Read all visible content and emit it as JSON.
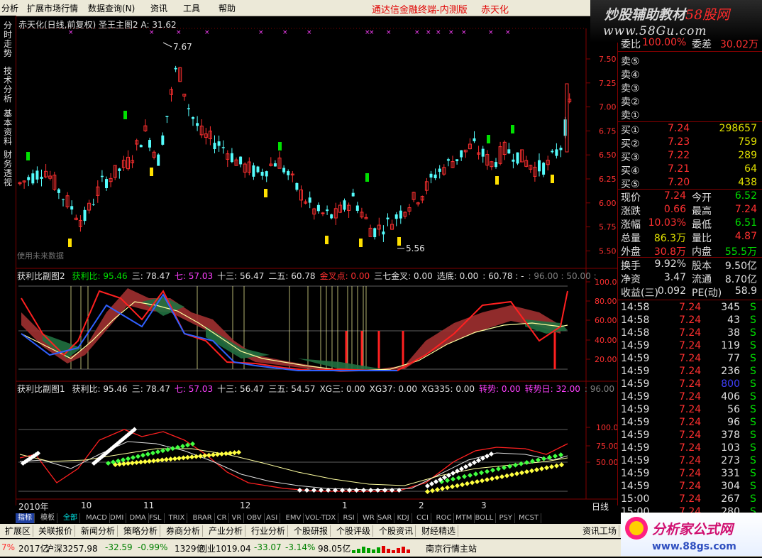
{
  "menu": [
    "分析",
    "扩展市场行情",
    "数据查询(N)",
    "资讯",
    "工具",
    "帮助"
  ],
  "app_title": "通达信金融终端-内测版",
  "stock_name_title": "赤天化",
  "brand": {
    "main": "炒股辅助教材",
    "accent": "58股网",
    "url": "www.58Gu.com"
  },
  "left_tabs": [
    "分时走势",
    "技术分析",
    "基本资料",
    "财务透视"
  ],
  "main_chart": {
    "header_name": "赤天化(日线,前复权)",
    "indicator": "圣王主图2",
    "a_label": "A: 31.62",
    "y_ticks": [
      "7.50",
      "7.25",
      "7.00",
      "6.75",
      "6.50",
      "6.25",
      "6.00",
      "5.75",
      "5.50"
    ],
    "y_values": [
      7.5,
      7.25,
      7.0,
      6.75,
      6.5,
      6.25,
      6.0,
      5.75,
      5.5
    ],
    "high_label": "7.67",
    "low_label": "5.56",
    "watermark": "使用未来数据"
  },
  "sub1": {
    "name": "获利比副图2",
    "items": [
      {
        "t": "获利比: 95.46",
        "c": "#00e000"
      },
      {
        "t": "三: 78.47",
        "c": "#e0e0e0"
      },
      {
        "t": "七: 57.03",
        "c": "#ff40ff"
      },
      {
        "t": "十三: 56.47",
        "c": "#e0e0e0"
      },
      {
        "t": "二五: 60.78",
        "c": "#e0e0e0"
      },
      {
        "t": "金叉点: 0.00",
        "c": "#ff3030"
      },
      {
        "t": "三七金叉: 0.00",
        "c": "#e0e0e0"
      },
      {
        "t": "选底: 0.00",
        "c": "#e0e0e0"
      },
      {
        "t": ": 60.78 : -",
        "c": "#e0e0e0"
      },
      {
        "t": ": 96.00 : 50.00 :",
        "c": "#808080"
      }
    ],
    "y_ticks": [
      "100.0",
      "80.00",
      "60.00",
      "40.00",
      "20.00"
    ]
  },
  "sub2": {
    "name": "获利比副图1",
    "items": [
      {
        "t": "获利比: 95.46",
        "c": "#e0e0e0"
      },
      {
        "t": "三: 78.47",
        "c": "#e0e0e0"
      },
      {
        "t": "七: 57.03",
        "c": "#ff40ff"
      },
      {
        "t": "十三: 56.47",
        "c": "#e0e0e0"
      },
      {
        "t": "三五: 54.57",
        "c": "#e0e0e0"
      },
      {
        "t": "XG三: 0.00",
        "c": "#e0e0e0"
      },
      {
        "t": "XG37: 0.00",
        "c": "#e0e0e0"
      },
      {
        "t": "XG335: 0.00",
        "c": "#e0e0e0"
      },
      {
        "t": "转势: 0.00",
        "c": "#ff40ff"
      },
      {
        "t": "转势日: 32.00",
        "c": "#ff40ff"
      },
      {
        "t": ": 96.00",
        "c": "#808080"
      }
    ],
    "y_ticks": [
      "100.0",
      "75.00",
      "50.00"
    ]
  },
  "date_axis": {
    "labels": [
      "2010年",
      "10",
      "11",
      "12",
      "1",
      "2",
      "3"
    ],
    "period": "日线"
  },
  "quote": {
    "top": {
      "label1": "委比",
      "val1": "100.00%",
      "label2": "委差",
      "val2": "30.02万"
    },
    "sell": [
      {
        "label": "卖⑤"
      },
      {
        "label": "卖④"
      },
      {
        "label": "卖③"
      },
      {
        "label": "卖②"
      },
      {
        "label": "卖①"
      }
    ],
    "buy": [
      {
        "label": "买①",
        "price": "7.24",
        "vol": "298657"
      },
      {
        "label": "买②",
        "price": "7.23",
        "vol": "759"
      },
      {
        "label": "买③",
        "price": "7.22",
        "vol": "289"
      },
      {
        "label": "买④",
        "price": "7.21",
        "vol": "64"
      },
      {
        "label": "买⑤",
        "price": "7.20",
        "vol": "438"
      }
    ],
    "stats": [
      {
        "l1": "现价",
        "v1": "7.24",
        "c1": "red",
        "l2": "今开",
        "v2": "6.52",
        "c2": "grn"
      },
      {
        "l1": "涨跌",
        "v1": "0.66",
        "c1": "red",
        "l2": "最高",
        "v2": "7.24",
        "c2": "red"
      },
      {
        "l1": "涨幅",
        "v1": "10.03%",
        "c1": "red",
        "l2": "最低",
        "v2": "6.51",
        "c2": "grn"
      },
      {
        "l1": "总量",
        "v1": "86.3万",
        "c1": "ylw",
        "l2": "量比",
        "v2": "4.87",
        "c2": "red"
      },
      {
        "l1": "外盘",
        "v1": "30.8万",
        "c1": "red",
        "l2": "内盘",
        "v2": "55.5万",
        "c2": "grn"
      }
    ],
    "stats2": [
      {
        "l1": "换手",
        "v1": "9.92%",
        "l2": "股本",
        "v2": "9.50亿"
      },
      {
        "l1": "净资",
        "v1": "3.47",
        "l2": "流通",
        "v2": "8.70亿"
      },
      {
        "l1": "收益(三)",
        "v1": "0.092",
        "l2": "PE(动)",
        "v2": "58.9"
      }
    ],
    "ticks": [
      {
        "time": "14:58",
        "price": "7.24",
        "vol": "345",
        "side": "S",
        "vc": "wht"
      },
      {
        "time": "14:58",
        "price": "7.24",
        "vol": "43",
        "side": "S",
        "vc": "wht"
      },
      {
        "time": "14:58",
        "price": "7.24",
        "vol": "38",
        "side": "S",
        "vc": "wht"
      },
      {
        "time": "14:59",
        "price": "7.24",
        "vol": "119",
        "side": "S",
        "vc": "wht"
      },
      {
        "time": "14:59",
        "price": "7.24",
        "vol": "77",
        "side": "S",
        "vc": "wht"
      },
      {
        "time": "14:59",
        "price": "7.24",
        "vol": "236",
        "side": "S",
        "vc": "wht"
      },
      {
        "time": "14:59",
        "price": "7.24",
        "vol": "800",
        "side": "S",
        "vc": "blu"
      },
      {
        "time": "14:59",
        "price": "7.24",
        "vol": "406",
        "side": "S",
        "vc": "wht"
      },
      {
        "time": "14:59",
        "price": "7.24",
        "vol": "56",
        "side": "S",
        "vc": "wht"
      },
      {
        "time": "14:59",
        "price": "7.24",
        "vol": "96",
        "side": "S",
        "vc": "wht"
      },
      {
        "time": "14:59",
        "price": "7.24",
        "vol": "378",
        "side": "S",
        "vc": "wht"
      },
      {
        "time": "14:59",
        "price": "7.24",
        "vol": "103",
        "side": "S",
        "vc": "wht"
      },
      {
        "time": "14:59",
        "price": "7.24",
        "vol": "273",
        "side": "S",
        "vc": "wht"
      },
      {
        "time": "14:59",
        "price": "7.24",
        "vol": "331",
        "side": "S",
        "vc": "wht"
      },
      {
        "time": "14:59",
        "price": "7.24",
        "vol": "304",
        "side": "S",
        "vc": "wht"
      },
      {
        "time": "15:00",
        "price": "7.24",
        "vol": "267",
        "side": "S",
        "vc": "wht"
      },
      {
        "time": "15:00",
        "price": "7.24",
        "vol": "280",
        "side": "S",
        "vc": "wht"
      }
    ]
  },
  "toolbar": [
    "指标",
    "模板",
    "全部",
    "MACD",
    "DMI",
    "DMA",
    "FSL",
    "TRIX",
    "BRAR",
    "CR",
    "VR",
    "OBV",
    "ASI",
    "EMV",
    "VOL-TDX",
    "RSI",
    "WR",
    "SAR",
    "KDJ",
    "CCI",
    "ROC",
    "MTM",
    "BOLL",
    "PSY",
    "MCST"
  ],
  "bottom_tabs": [
    "扩展区",
    "关联报价",
    "新闻分析",
    "策略分析",
    "券商分析",
    "产业分析",
    "行业分析",
    "个股研报",
    "个股评级",
    "个股资讯",
    "财经精选"
  ],
  "bottom_right": "资讯工场",
  "status": {
    "s1": "7%",
    "s2": "2017亿",
    "s3": "沪深3257.98",
    "s4": "-32.59",
    "s5": "-0.99%",
    "s6": "1329亿",
    "s7": "创业1019.04",
    "s8": "-33.07",
    "s9": "-3.14%",
    "s10": "98.05亿",
    "s11": "南京行情主站"
  },
  "logo": {
    "text": "分析家公式网",
    "url": "www.88gs.com"
  },
  "colors": {
    "up": "#ff3030",
    "down": "#54fcfc",
    "frame": "#800000",
    "bg": "#000000"
  }
}
